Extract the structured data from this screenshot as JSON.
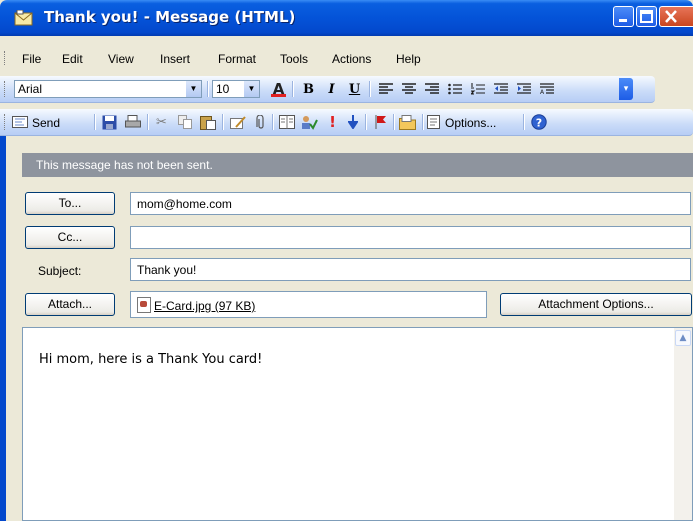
{
  "window": {
    "title": "Thank you! - Message (HTML)"
  },
  "menubar": {
    "items": [
      {
        "label": "File",
        "mnemonic": "F"
      },
      {
        "label": "Edit",
        "mnemonic": "E"
      },
      {
        "label": "View",
        "mnemonic": "V"
      },
      {
        "label": "Insert",
        "mnemonic": "I"
      },
      {
        "label": "Format",
        "mnemonic": "o"
      },
      {
        "label": "Tools",
        "mnemonic": "T"
      },
      {
        "label": "Actions",
        "mnemonic": "A"
      },
      {
        "label": "Help",
        "mnemonic": "H"
      }
    ]
  },
  "formatting_toolbar": {
    "font": "Arial",
    "size": "10",
    "icons": [
      "font-color-icon",
      "bold-icon",
      "italic-icon",
      "underline-icon",
      "align-left-icon",
      "align-center-icon",
      "align-right-icon",
      "bullets-icon",
      "numbering-icon",
      "decrease-indent-icon",
      "increase-indent-icon",
      "style-icon"
    ]
  },
  "standard_toolbar": {
    "send_label": "Send",
    "options_label": "Options...",
    "icons": [
      "save-icon",
      "print-icon",
      "cut-icon",
      "copy-icon",
      "paste-icon",
      "signature-icon",
      "paperclip-icon",
      "address-book-icon",
      "check-names-icon",
      "high-importance-icon",
      "low-importance-icon",
      "flag-icon",
      "folder-icon",
      "options-icon",
      "help-icon"
    ]
  },
  "infobar": {
    "text": "This message has not been sent."
  },
  "fields": {
    "to_label": "To...",
    "to_value": "mom@home.com",
    "cc_label": "Cc...",
    "cc_value": "",
    "subject_label": "Subject:",
    "subject_value": "Thank you!",
    "attach_label": "Attach...",
    "attachment_name": "E-Card.jpg (97 KB)",
    "attachment_options_label": "Attachment Options..."
  },
  "message_body": {
    "text": "Hi mom, here is a Thank You card!"
  },
  "colors": {
    "titlebar": "#0453D8",
    "toolbar": "#C9DBF8",
    "infobar": "#8E949E",
    "window_bg": "#ECE9D8"
  }
}
